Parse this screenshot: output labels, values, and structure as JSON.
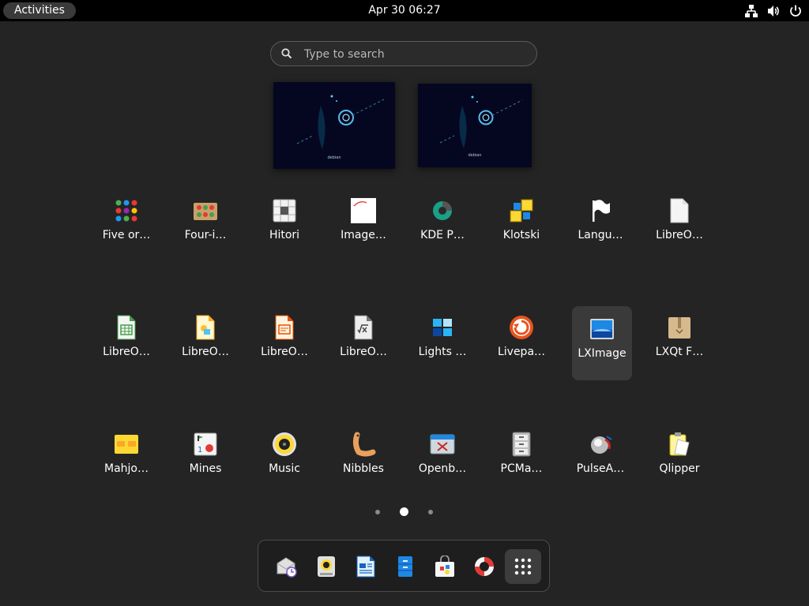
{
  "topbar": {
    "activities": "Activities",
    "clock": "Apr 30  06:27",
    "tray": [
      "network-icon",
      "volume-icon",
      "power-icon"
    ]
  },
  "search": {
    "placeholder": "Type to search",
    "value": ""
  },
  "workspaces": [
    {
      "label": "debian"
    },
    {
      "label": "debian"
    }
  ],
  "apps": [
    {
      "label": "Five or…",
      "icon": "five-or-more-icon"
    },
    {
      "label": "Four-i…",
      "icon": "four-in-a-row-icon"
    },
    {
      "label": "Hitori",
      "icon": "hitori-icon"
    },
    {
      "label": "Image…",
      "icon": "image-viewer-icon"
    },
    {
      "label": "KDE P…",
      "icon": "kde-partition-icon"
    },
    {
      "label": "Klotski",
      "icon": "klotski-icon"
    },
    {
      "label": "Langu…",
      "icon": "language-flag-icon"
    },
    {
      "label": "LibreO…",
      "icon": "libreoffice-icon"
    },
    {
      "label": "LibreO…",
      "icon": "libreoffice-calc-icon"
    },
    {
      "label": "LibreO…",
      "icon": "libreoffice-draw-icon"
    },
    {
      "label": "LibreO…",
      "icon": "libreoffice-impress-icon"
    },
    {
      "label": "LibreO…",
      "icon": "libreoffice-math-icon"
    },
    {
      "label": "Lights …",
      "icon": "lights-off-icon"
    },
    {
      "label": "Livepa…",
      "icon": "livepatch-icon"
    },
    {
      "label": "LXImage",
      "icon": "lximage-icon",
      "selected": true
    },
    {
      "label": "LXQt F…",
      "icon": "lxqt-file-archiver-icon"
    },
    {
      "label": "Mahjo…",
      "icon": "mahjongg-icon"
    },
    {
      "label": "Mines",
      "icon": "mines-icon"
    },
    {
      "label": "Music",
      "icon": "music-icon"
    },
    {
      "label": "Nibbles",
      "icon": "nibbles-icon"
    },
    {
      "label": "Openb…",
      "icon": "openbox-icon"
    },
    {
      "label": "PCMa…",
      "icon": "pcmanfm-icon"
    },
    {
      "label": "PulseA…",
      "icon": "pulseaudio-icon"
    },
    {
      "label": "Qlipper",
      "icon": "qlipper-icon"
    }
  ],
  "pager": {
    "pages": 3,
    "current": 2
  },
  "dash": [
    {
      "icon": "evolution-mail-icon"
    },
    {
      "icon": "rhythmbox-speaker-icon"
    },
    {
      "icon": "libreoffice-writer-icon"
    },
    {
      "icon": "file-cabinet-icon"
    },
    {
      "icon": "software-store-icon"
    },
    {
      "icon": "help-lifebuoy-icon"
    },
    {
      "icon": "show-apps-grid-icon",
      "selected": true
    }
  ],
  "colors": {
    "background": "#242424",
    "topbar": "#000000",
    "selected": "#3a3a3a"
  }
}
